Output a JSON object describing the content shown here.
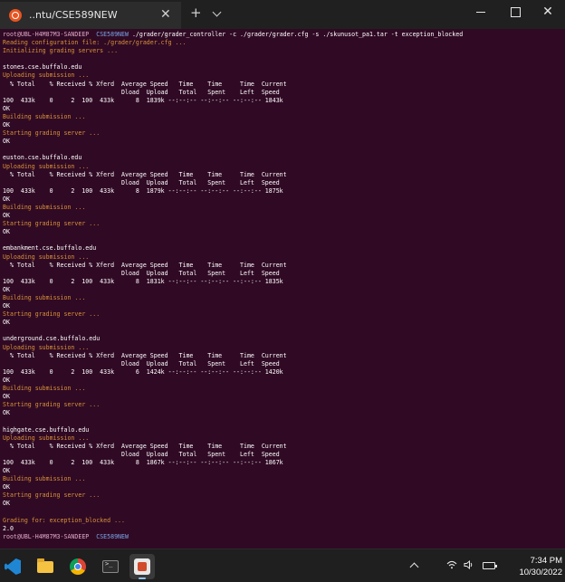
{
  "window": {
    "tab_title": "..ntu/CSE589NEW",
    "tab_close": "✕",
    "new_tab": "+",
    "close": "✕"
  },
  "colors": {
    "terminal_bg": "#300a24",
    "prompt": "#e0a8c8",
    "path": "#7aa6e8",
    "status_orange": "#d9923a",
    "text": "#ffffff"
  },
  "terminal": {
    "prompt_user": "root@UBL-H4M87M3-SANDEEP",
    "prompt_path": "CSE589NEW",
    "command": "./grader/grader_controller -c ./grader/grader.cfg -s ./skunusot_pa1.tar -t exception_blocked",
    "intro": [
      "Reading configuration file: ./grader/grader.cfg ...",
      "Initializing grading servers ..."
    ],
    "uploading": "Uploading submission ...",
    "header1": "  % Total    % Received % Xferd  Average Speed   Time    Time     Time  Current",
    "header2": "                                 Dload  Upload   Total   Spent    Left  Speed",
    "ok": "OK",
    "building": "Building submission ...",
    "starting": "Starting grading server ...",
    "servers": [
      {
        "host": "stones.cse.buffalo.edu",
        "progress": "100  433k    0     2  100  433k      8  1839k --:--:-- --:--:-- --:--:-- 1843k"
      },
      {
        "host": "euston.cse.buffalo.edu",
        "progress": "100  433k    0     2  100  433k      8  1879k --:--:-- --:--:-- --:--:-- 1875k"
      },
      {
        "host": "embankment.cse.buffalo.edu",
        "progress": "100  433k    0     2  100  433k      8  1831k --:--:-- --:--:-- --:--:-- 1835k"
      },
      {
        "host": "underground.cse.buffalo.edu",
        "progress": "100  433k    0     2  100  433k      6  1424k --:--:-- --:--:-- --:--:-- 1420k"
      },
      {
        "host": "highgate.cse.buffalo.edu",
        "progress": "100  433k    0     2  100  433k      8  1867k --:--:-- --:--:-- --:--:-- 1867k"
      }
    ],
    "grading_for": "Grading for: exception_blocked ...",
    "score": "2.0"
  },
  "taskbar": {
    "apps": [
      "vscode-icon",
      "file-explorer-icon",
      "chrome-icon",
      "terminal-icon",
      "wsl-icon"
    ],
    "time": "7:34 PM",
    "date": "10/30/2022"
  }
}
